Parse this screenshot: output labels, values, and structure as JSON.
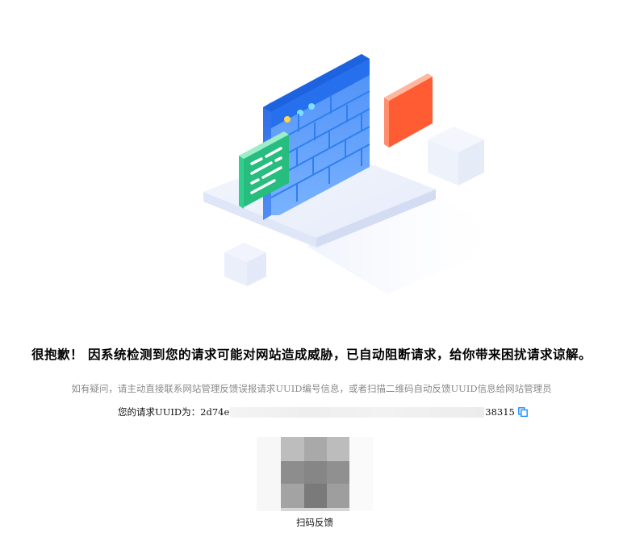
{
  "page": {
    "headline": "很抱歉！ 因系统检测到您的请求可能对网站造成威胁，已自动阻断请求，给你带来困扰请求谅解。",
    "hint": "如有疑问，请主动直接联系网站管理反馈误报请求UUID编号信息，或者扫描二维码自动反馈UUID信息给网站管理员",
    "uuid_label": "您的请求UUID为：",
    "uuid_prefix": "2d74e",
    "uuid_suffix": "38315",
    "qr_caption": "扫码反馈"
  },
  "icons": {
    "copy": "copy-icon",
    "firewall": "firewall-illustration-icon"
  },
  "colors": {
    "accent_blue": "#1a8cff",
    "firewall_blue": "#3f84f5",
    "orange_block": "#ff5c33",
    "green_card": "#27c286",
    "hint_gray": "#8a8a8a"
  }
}
